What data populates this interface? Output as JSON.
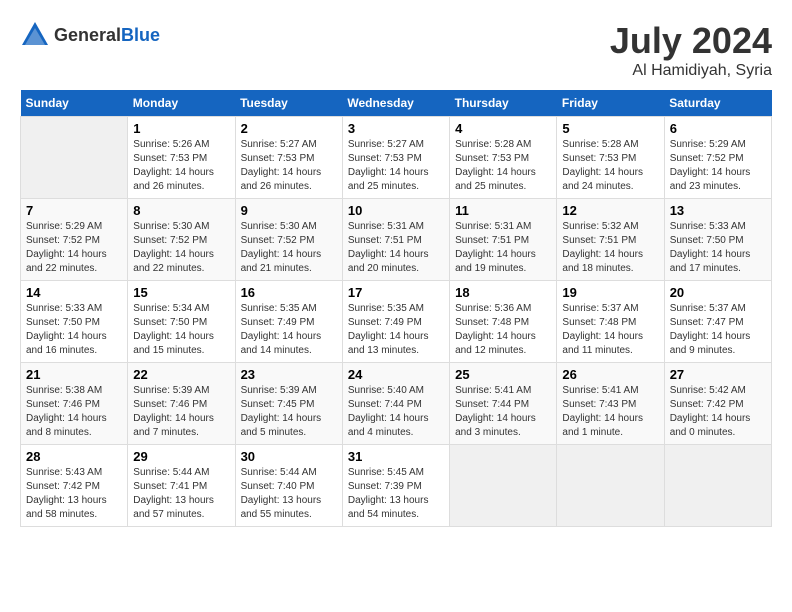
{
  "header": {
    "logo_general": "General",
    "logo_blue": "Blue",
    "month_year": "July 2024",
    "location": "Al Hamidiyah, Syria"
  },
  "weekdays": [
    "Sunday",
    "Monday",
    "Tuesday",
    "Wednesday",
    "Thursday",
    "Friday",
    "Saturday"
  ],
  "weeks": [
    [
      {
        "day": "",
        "empty": true
      },
      {
        "day": "1",
        "sunrise": "Sunrise: 5:26 AM",
        "sunset": "Sunset: 7:53 PM",
        "daylight": "Daylight: 14 hours and 26 minutes."
      },
      {
        "day": "2",
        "sunrise": "Sunrise: 5:27 AM",
        "sunset": "Sunset: 7:53 PM",
        "daylight": "Daylight: 14 hours and 26 minutes."
      },
      {
        "day": "3",
        "sunrise": "Sunrise: 5:27 AM",
        "sunset": "Sunset: 7:53 PM",
        "daylight": "Daylight: 14 hours and 25 minutes."
      },
      {
        "day": "4",
        "sunrise": "Sunrise: 5:28 AM",
        "sunset": "Sunset: 7:53 PM",
        "daylight": "Daylight: 14 hours and 25 minutes."
      },
      {
        "day": "5",
        "sunrise": "Sunrise: 5:28 AM",
        "sunset": "Sunset: 7:53 PM",
        "daylight": "Daylight: 14 hours and 24 minutes."
      },
      {
        "day": "6",
        "sunrise": "Sunrise: 5:29 AM",
        "sunset": "Sunset: 7:52 PM",
        "daylight": "Daylight: 14 hours and 23 minutes."
      }
    ],
    [
      {
        "day": "7",
        "sunrise": "Sunrise: 5:29 AM",
        "sunset": "Sunset: 7:52 PM",
        "daylight": "Daylight: 14 hours and 22 minutes."
      },
      {
        "day": "8",
        "sunrise": "Sunrise: 5:30 AM",
        "sunset": "Sunset: 7:52 PM",
        "daylight": "Daylight: 14 hours and 22 minutes."
      },
      {
        "day": "9",
        "sunrise": "Sunrise: 5:30 AM",
        "sunset": "Sunset: 7:52 PM",
        "daylight": "Daylight: 14 hours and 21 minutes."
      },
      {
        "day": "10",
        "sunrise": "Sunrise: 5:31 AM",
        "sunset": "Sunset: 7:51 PM",
        "daylight": "Daylight: 14 hours and 20 minutes."
      },
      {
        "day": "11",
        "sunrise": "Sunrise: 5:31 AM",
        "sunset": "Sunset: 7:51 PM",
        "daylight": "Daylight: 14 hours and 19 minutes."
      },
      {
        "day": "12",
        "sunrise": "Sunrise: 5:32 AM",
        "sunset": "Sunset: 7:51 PM",
        "daylight": "Daylight: 14 hours and 18 minutes."
      },
      {
        "day": "13",
        "sunrise": "Sunrise: 5:33 AM",
        "sunset": "Sunset: 7:50 PM",
        "daylight": "Daylight: 14 hours and 17 minutes."
      }
    ],
    [
      {
        "day": "14",
        "sunrise": "Sunrise: 5:33 AM",
        "sunset": "Sunset: 7:50 PM",
        "daylight": "Daylight: 14 hours and 16 minutes."
      },
      {
        "day": "15",
        "sunrise": "Sunrise: 5:34 AM",
        "sunset": "Sunset: 7:50 PM",
        "daylight": "Daylight: 14 hours and 15 minutes."
      },
      {
        "day": "16",
        "sunrise": "Sunrise: 5:35 AM",
        "sunset": "Sunset: 7:49 PM",
        "daylight": "Daylight: 14 hours and 14 minutes."
      },
      {
        "day": "17",
        "sunrise": "Sunrise: 5:35 AM",
        "sunset": "Sunset: 7:49 PM",
        "daylight": "Daylight: 14 hours and 13 minutes."
      },
      {
        "day": "18",
        "sunrise": "Sunrise: 5:36 AM",
        "sunset": "Sunset: 7:48 PM",
        "daylight": "Daylight: 14 hours and 12 minutes."
      },
      {
        "day": "19",
        "sunrise": "Sunrise: 5:37 AM",
        "sunset": "Sunset: 7:48 PM",
        "daylight": "Daylight: 14 hours and 11 minutes."
      },
      {
        "day": "20",
        "sunrise": "Sunrise: 5:37 AM",
        "sunset": "Sunset: 7:47 PM",
        "daylight": "Daylight: 14 hours and 9 minutes."
      }
    ],
    [
      {
        "day": "21",
        "sunrise": "Sunrise: 5:38 AM",
        "sunset": "Sunset: 7:46 PM",
        "daylight": "Daylight: 14 hours and 8 minutes."
      },
      {
        "day": "22",
        "sunrise": "Sunrise: 5:39 AM",
        "sunset": "Sunset: 7:46 PM",
        "daylight": "Daylight: 14 hours and 7 minutes."
      },
      {
        "day": "23",
        "sunrise": "Sunrise: 5:39 AM",
        "sunset": "Sunset: 7:45 PM",
        "daylight": "Daylight: 14 hours and 5 minutes."
      },
      {
        "day": "24",
        "sunrise": "Sunrise: 5:40 AM",
        "sunset": "Sunset: 7:44 PM",
        "daylight": "Daylight: 14 hours and 4 minutes."
      },
      {
        "day": "25",
        "sunrise": "Sunrise: 5:41 AM",
        "sunset": "Sunset: 7:44 PM",
        "daylight": "Daylight: 14 hours and 3 minutes."
      },
      {
        "day": "26",
        "sunrise": "Sunrise: 5:41 AM",
        "sunset": "Sunset: 7:43 PM",
        "daylight": "Daylight: 14 hours and 1 minute."
      },
      {
        "day": "27",
        "sunrise": "Sunrise: 5:42 AM",
        "sunset": "Sunset: 7:42 PM",
        "daylight": "Daylight: 14 hours and 0 minutes."
      }
    ],
    [
      {
        "day": "28",
        "sunrise": "Sunrise: 5:43 AM",
        "sunset": "Sunset: 7:42 PM",
        "daylight": "Daylight: 13 hours and 58 minutes."
      },
      {
        "day": "29",
        "sunrise": "Sunrise: 5:44 AM",
        "sunset": "Sunset: 7:41 PM",
        "daylight": "Daylight: 13 hours and 57 minutes."
      },
      {
        "day": "30",
        "sunrise": "Sunrise: 5:44 AM",
        "sunset": "Sunset: 7:40 PM",
        "daylight": "Daylight: 13 hours and 55 minutes."
      },
      {
        "day": "31",
        "sunrise": "Sunrise: 5:45 AM",
        "sunset": "Sunset: 7:39 PM",
        "daylight": "Daylight: 13 hours and 54 minutes."
      },
      {
        "day": "",
        "empty": true
      },
      {
        "day": "",
        "empty": true
      },
      {
        "day": "",
        "empty": true
      }
    ]
  ]
}
